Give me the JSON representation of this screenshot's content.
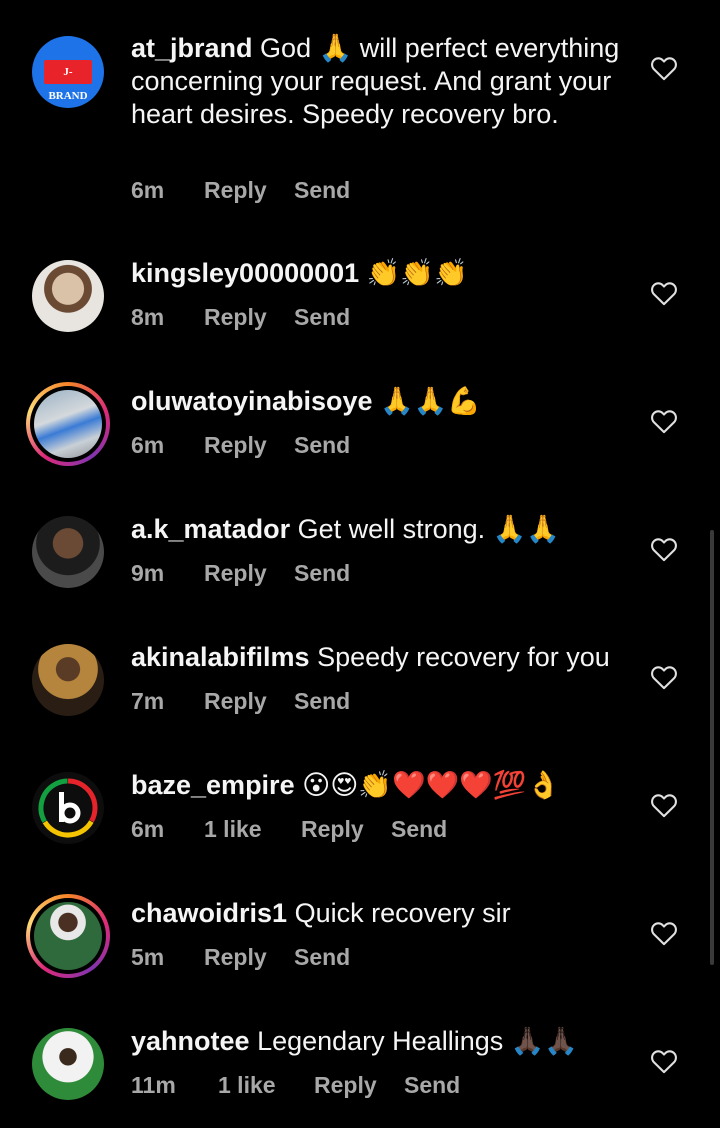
{
  "comments": [
    {
      "username": "at_jbrand",
      "text": "God 🙏 will perfect everything concerning your request. And grant your heart desires. Speedy recovery bro.",
      "time": "6m",
      "likes": "",
      "reply_label": "Reply",
      "send_label": "Send",
      "avatar_label": "J-BRAND"
    },
    {
      "username": "kingsley00000001",
      "text": "👏👏👏",
      "time": "8m",
      "likes": "",
      "reply_label": "Reply",
      "send_label": "Send"
    },
    {
      "username": "oluwatoyinabisoye",
      "text": "🙏🙏💪",
      "time": "6m",
      "likes": "",
      "reply_label": "Reply",
      "send_label": "Send"
    },
    {
      "username": "a.k_matador",
      "text": "Get well strong. 🙏🙏",
      "time": "9m",
      "likes": "",
      "reply_label": "Reply",
      "send_label": "Send"
    },
    {
      "username": "akinalabifilms",
      "text": "Speedy recovery for you",
      "time": "7m",
      "likes": "",
      "reply_label": "Reply",
      "send_label": "Send"
    },
    {
      "username": "baze_empire",
      "text": "😮😍👏❤️❤️❤️💯👌",
      "time": "6m",
      "likes": "1 like",
      "reply_label": "Reply",
      "send_label": "Send"
    },
    {
      "username": "chawoidris1",
      "text": "Quick recovery sir",
      "time": "5m",
      "likes": "",
      "reply_label": "Reply",
      "send_label": "Send"
    },
    {
      "username": "yahnotee",
      "text": "Legendary Heallings 🙏🏿🙏🏿",
      "time": "11m",
      "likes": "1 like",
      "reply_label": "Reply",
      "send_label": "Send"
    }
  ],
  "colors": {
    "background": "#000000",
    "text": "#f5f5f5",
    "meta": "#a8a8a8",
    "story_ring": "#dd2a7b"
  },
  "icons": {
    "like": "heart-outline-icon"
  }
}
